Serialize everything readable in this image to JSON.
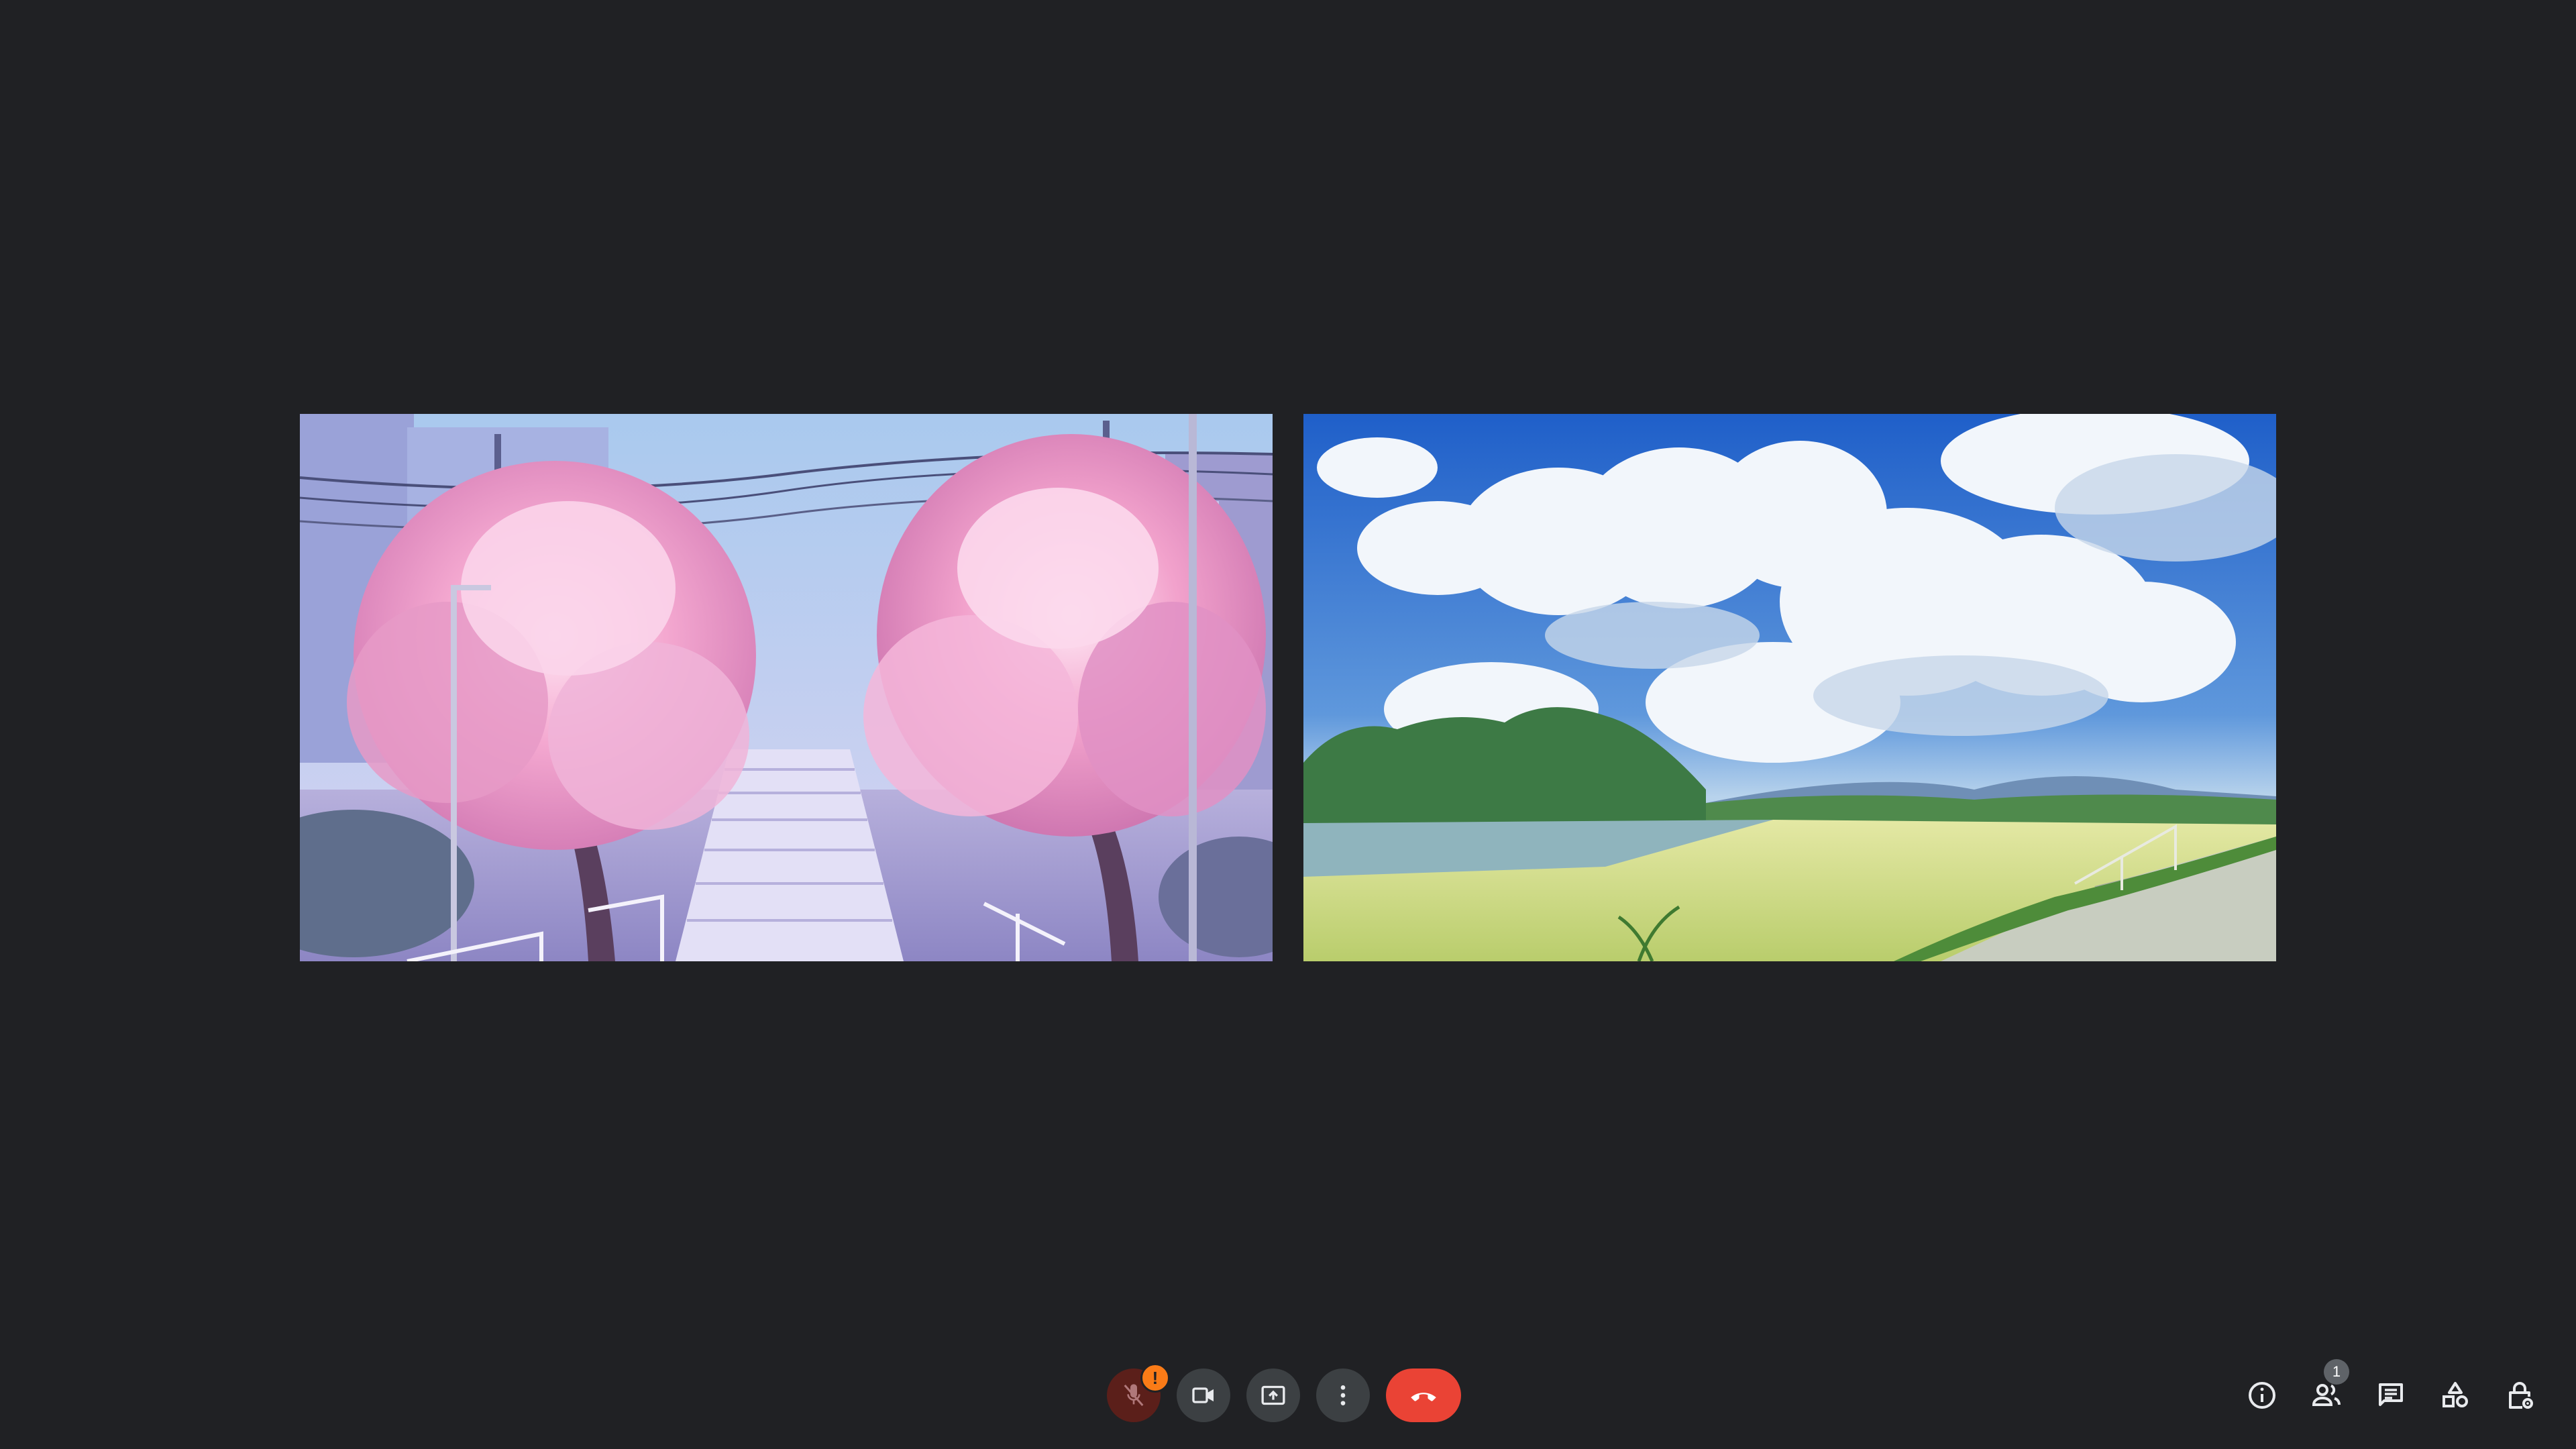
{
  "meeting": {
    "participant_count": "1",
    "mic_alert": "!"
  },
  "tiles": [
    {
      "scene": "cherry-blossom-stairs"
    },
    {
      "scene": "summer-clouds-field"
    }
  ],
  "colors": {
    "background": "#202124",
    "control_button": "#3c4043",
    "mic_muted_button": "#5b1f1a",
    "leave_button": "#ea4335",
    "alert_badge": "#fa7b17",
    "count_badge": "#5f6368",
    "icon": "#e8eaed"
  },
  "controls": {
    "center": [
      {
        "icon": "mic-off-icon"
      },
      {
        "icon": "videocam-icon"
      },
      {
        "icon": "present-screen-icon"
      },
      {
        "icon": "more-vert-icon"
      },
      {
        "icon": "call-end-icon"
      }
    ],
    "right": [
      {
        "icon": "info-icon"
      },
      {
        "icon": "people-icon"
      },
      {
        "icon": "chat-icon"
      },
      {
        "icon": "activities-icon"
      },
      {
        "icon": "host-controls-icon"
      }
    ]
  }
}
